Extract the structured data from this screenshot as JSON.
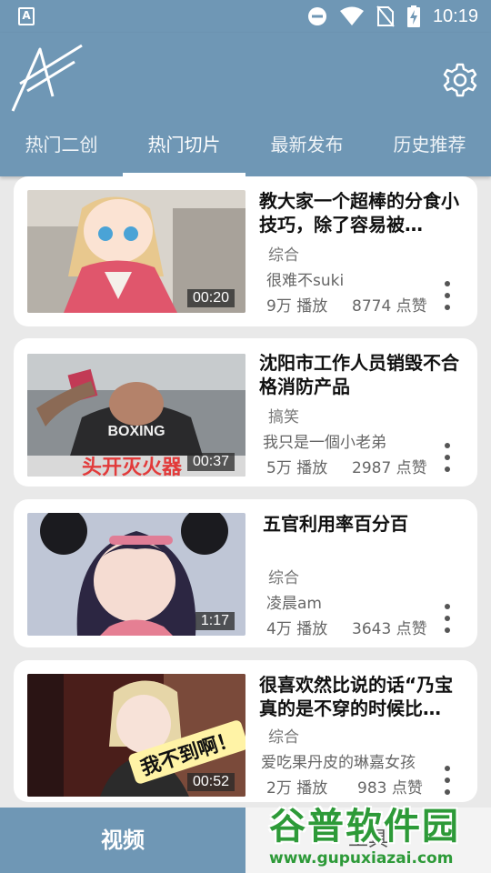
{
  "status_bar": {
    "time": "10:19",
    "notification_icon_letter": "A"
  },
  "tabs": [
    {
      "label": "热门二创"
    },
    {
      "label": "热门切片"
    },
    {
      "label": "最新发布"
    },
    {
      "label": "历史推荐"
    }
  ],
  "active_tab": 1,
  "videos": [
    {
      "title": "教大家一个超棒的分食小技巧，除了容易被…",
      "category": "综合",
      "author": "很难不suki",
      "plays": "9万 播放",
      "likes": "8774 点赞",
      "duration": "00:20"
    },
    {
      "title": "沈阳市工作人员销毁不合格消防产品",
      "category": "搞笑",
      "author": "我只是一個小老弟",
      "plays": "5万 播放",
      "likes": "2987 点赞",
      "duration": "00:37"
    },
    {
      "title": "五官利用率百分百",
      "category": "综合",
      "author": "凌晨am",
      "plays": "4万 播放",
      "likes": "3643 点赞",
      "duration": "1:17"
    },
    {
      "title": "很喜欢然比说的话“乃宝真的是不穿的时候比…",
      "category": "综合",
      "author": "爱吃果丹皮的琳嘉女孩",
      "plays": "2万 播放",
      "likes": "983 点赞",
      "duration": "00:52"
    }
  ],
  "thumb_texts": {
    "boxing_shirt": "BOXING",
    "bottom_caption": "头开灭火器",
    "sticker": "我不到啊！"
  },
  "bottom_nav": {
    "video_label": "视频",
    "other_label": "工具"
  },
  "watermark": {
    "title": "谷普软件园",
    "url": "www.gupuxiazai.com"
  },
  "colors": {
    "header": "#6f97b5",
    "card": "#ffffff",
    "background": "#e9e9e9",
    "watermark": "#2d9a38"
  }
}
